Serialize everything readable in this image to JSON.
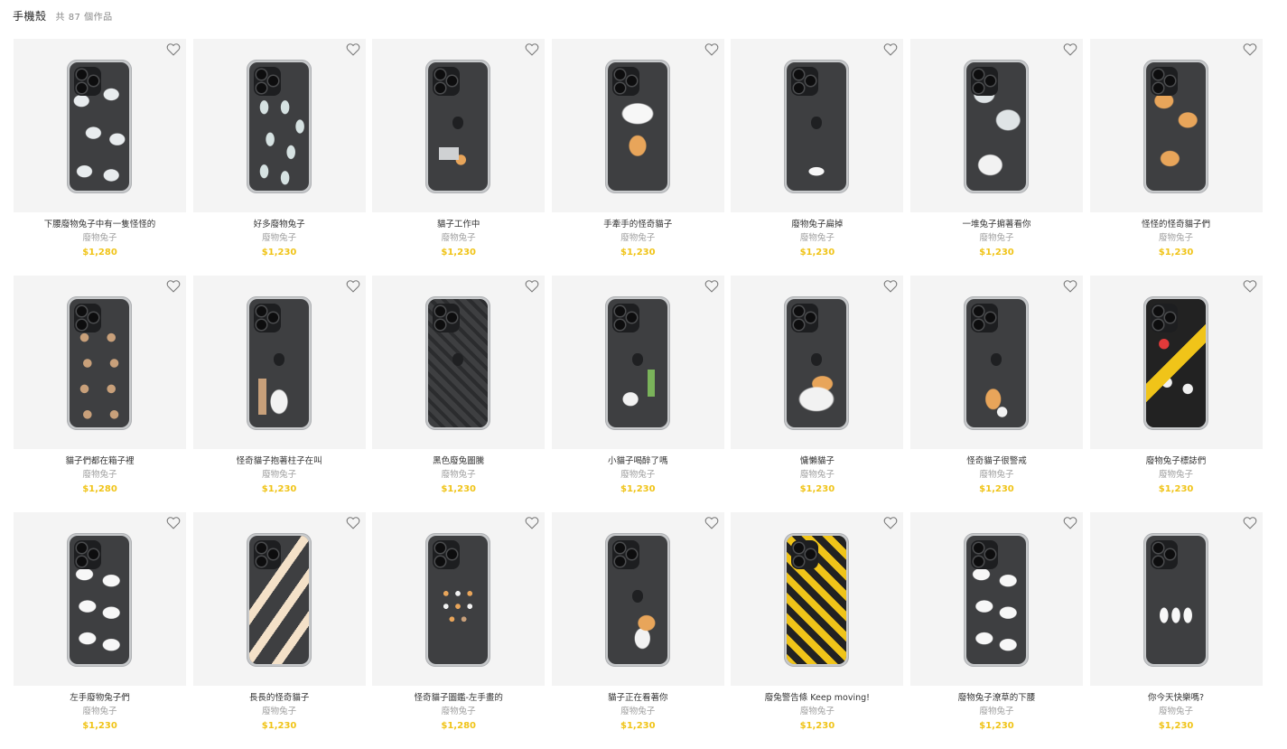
{
  "header": {
    "title": "手機殼",
    "count": "共 87 個作品"
  },
  "colors": {
    "price": "#f0c419",
    "thumb_bg": "#f4f4f4",
    "author": "#a0a0a0"
  },
  "products": [
    {
      "name": "下腰廢物兔子中有一隻怪怪的",
      "author": "廢物兔子",
      "price": "$1,280",
      "pattern": "blobs",
      "logo": false
    },
    {
      "name": "好多廢物兔子",
      "author": "廢物兔子",
      "price": "$1,230",
      "pattern": "rabbits",
      "logo": false
    },
    {
      "name": "貓子工作中",
      "author": "廢物兔子",
      "price": "$1,230",
      "pattern": "laptop",
      "logo": true
    },
    {
      "name": "手牽手的怪奇貓子",
      "author": "廢物兔子",
      "price": "$1,230",
      "pattern": "hug",
      "logo": false
    },
    {
      "name": "廢物兔子扁掉",
      "author": "廢物兔子",
      "price": "$1,230",
      "pattern": "flat-rabbit",
      "logo": true
    },
    {
      "name": "一堆兔子掮著看你",
      "author": "廢物兔子",
      "price": "$1,230",
      "pattern": "rabbit-pile",
      "logo": false
    },
    {
      "name": "怪怪的怪奇貓子們",
      "author": "廢物兔子",
      "price": "$1,230",
      "pattern": "weird-cats",
      "logo": false
    },
    {
      "name": "貓子們都在箱子裡",
      "author": "廢物兔子",
      "price": "$1,280",
      "pattern": "boxes",
      "logo": false
    },
    {
      "name": "怪奇貓子抱著柱子在叫",
      "author": "廢物兔子",
      "price": "$1,230",
      "pattern": "pillar",
      "logo": true
    },
    {
      "name": "黑色廢兔圖騰",
      "author": "廢物兔子",
      "price": "$1,230",
      "pattern": "diamond",
      "logo": true
    },
    {
      "name": "小貓子喝醉了嗎",
      "author": "廢物兔子",
      "price": "$1,230",
      "pattern": "bottle",
      "logo": true
    },
    {
      "name": "慵懶貓子",
      "author": "廢物兔子",
      "price": "$1,230",
      "pattern": "lazy",
      "logo": true
    },
    {
      "name": "怪奇貓子很警戒",
      "author": "廢物兔子",
      "price": "$1,230",
      "pattern": "vigilant",
      "logo": true
    },
    {
      "name": "廢物兔子標誌們",
      "author": "廢物兔子",
      "price": "$1,230",
      "pattern": "signs",
      "logo": false
    },
    {
      "name": "左手廢物兔子們",
      "author": "廢物兔子",
      "price": "$1,230",
      "pattern": "white-blobs",
      "logo": false
    },
    {
      "name": "長長的怪奇貓子",
      "author": "廢物兔子",
      "price": "$1,230",
      "pattern": "arms",
      "logo": false
    },
    {
      "name": "怪奇貓子圖鑑-左手畫的",
      "author": "廢物兔子",
      "price": "$1,280",
      "pattern": "small",
      "logo": false
    },
    {
      "name": "貓子正在看著你",
      "author": "廢物兔子",
      "price": "$1,230",
      "pattern": "one-cat",
      "logo": true
    },
    {
      "name": "廢兔警告條 Keep moving!",
      "author": "廢物兔子",
      "price": "$1,230",
      "pattern": "stripes",
      "logo": false
    },
    {
      "name": "廢物兔子潦草的下腰",
      "author": "廢物兔子",
      "price": "$1,230",
      "pattern": "white-blobs",
      "logo": false
    },
    {
      "name": "你今天快樂嗎?",
      "author": "廢物兔子",
      "price": "$1,230",
      "pattern": "three-rabbits",
      "logo": false
    }
  ]
}
